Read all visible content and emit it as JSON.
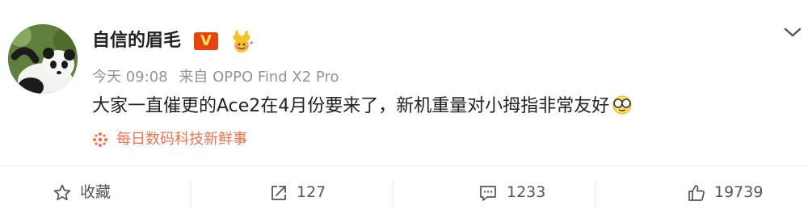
{
  "post": {
    "author": {
      "name": "自信的眉毛",
      "verified_badge": "V",
      "verified_color": "#e8430f",
      "avatar_icon": "panda-avatar",
      "member_icon": "crown-member-icon"
    },
    "meta": {
      "time": "今天 09:08",
      "source": "来自 OPPO Find X2 Pro"
    },
    "content": {
      "text": "大家一直催更的Ace2在4月份要来了，新机重量对小拇指非常友好",
      "emoji": "glasses-smile-emoji"
    },
    "topic": {
      "label": "每日数码科技新鲜事",
      "icon": "sparkle-icon",
      "color": "#eb7350"
    },
    "menu_icon": "chevron-down-icon"
  },
  "actions": {
    "favorite": {
      "label": "收藏",
      "icon": "star-icon"
    },
    "repost": {
      "count": "127",
      "icon": "share-icon"
    },
    "comment": {
      "count": "1233",
      "icon": "comment-icon"
    },
    "like": {
      "count": "19739",
      "icon": "thumbs-up-icon"
    }
  }
}
